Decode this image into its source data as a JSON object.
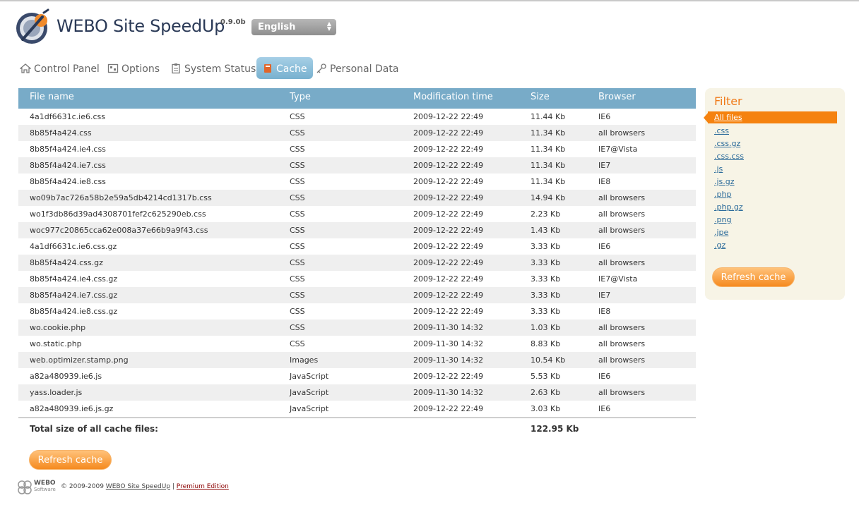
{
  "header": {
    "title": "WEBO Site SpeedUp",
    "version": "0.9.0b",
    "language": "English"
  },
  "nav": {
    "tabs": [
      {
        "label": "Control Panel",
        "icon": "home-icon"
      },
      {
        "label": "Options",
        "icon": "options-icon"
      },
      {
        "label": "System Status",
        "icon": "clipboard-icon"
      },
      {
        "label": "Cache",
        "icon": "book-icon",
        "active": true
      },
      {
        "label": "Personal Data",
        "icon": "key-icon"
      }
    ]
  },
  "table": {
    "headers": [
      "File name",
      "Type",
      "Modification time",
      "Size",
      "Browser"
    ],
    "rows": [
      [
        "4a1df6631c.ie6.css",
        "CSS",
        "2009-12-22 22:49",
        "11.44 Kb",
        "IE6"
      ],
      [
        "8b85f4a424.css",
        "CSS",
        "2009-12-22 22:49",
        "11.34 Kb",
        "all browsers"
      ],
      [
        "8b85f4a424.ie4.css",
        "CSS",
        "2009-12-22 22:49",
        "11.34 Kb",
        "IE7@Vista"
      ],
      [
        "8b85f4a424.ie7.css",
        "CSS",
        "2009-12-22 22:49",
        "11.34 Kb",
        "IE7"
      ],
      [
        "8b85f4a424.ie8.css",
        "CSS",
        "2009-12-22 22:49",
        "11.34 Kb",
        "IE8"
      ],
      [
        "wo09b7ac726a58b2e59a5db4214cd1317b.css",
        "CSS",
        "2009-12-22 22:49",
        "14.94 Kb",
        "all browsers"
      ],
      [
        "wo1f3db86d39ad4308701fef2c625290eb.css",
        "CSS",
        "2009-12-22 22:49",
        "2.23 Kb",
        "all browsers"
      ],
      [
        "woc977c20865cca62e008a37e66b9a9f43.css",
        "CSS",
        "2009-12-22 22:49",
        "1.43 Kb",
        "all browsers"
      ],
      [
        "4a1df6631c.ie6.css.gz",
        "CSS",
        "2009-12-22 22:49",
        "3.33 Kb",
        "IE6"
      ],
      [
        "8b85f4a424.css.gz",
        "CSS",
        "2009-12-22 22:49",
        "3.33 Kb",
        "all browsers"
      ],
      [
        "8b85f4a424.ie4.css.gz",
        "CSS",
        "2009-12-22 22:49",
        "3.33 Kb",
        "IE7@Vista"
      ],
      [
        "8b85f4a424.ie7.css.gz",
        "CSS",
        "2009-12-22 22:49",
        "3.33 Kb",
        "IE7"
      ],
      [
        "8b85f4a424.ie8.css.gz",
        "CSS",
        "2009-12-22 22:49",
        "3.33 Kb",
        "IE8"
      ],
      [
        "wo.cookie.php",
        "CSS",
        "2009-11-30 14:32",
        "1.03 Kb",
        "all browsers"
      ],
      [
        "wo.static.php",
        "CSS",
        "2009-11-30 14:32",
        "8.83 Kb",
        "all browsers"
      ],
      [
        "web.optimizer.stamp.png",
        "Images",
        "2009-11-30 14:32",
        "10.54 Kb",
        "all browsers"
      ],
      [
        "a82a480939.ie6.js",
        "JavaScript",
        "2009-12-22 22:49",
        "5.53 Kb",
        "IE6"
      ],
      [
        "yass.loader.js",
        "JavaScript",
        "2009-11-30 14:32",
        "2.63 Kb",
        "all browsers"
      ],
      [
        "a82a480939.ie6.js.gz",
        "JavaScript",
        "2009-12-22 22:49",
        "3.03 Kb",
        "IE6"
      ]
    ],
    "total_label": "Total size of all cache files:",
    "total_value": "122.95 Kb"
  },
  "refresh_label": "Refresh cache",
  "filter": {
    "title": "Filter",
    "active": "All files",
    "items": [
      ".css",
      ".css.gz",
      ".css.css",
      ".js",
      ".js.gz",
      ".php",
      ".php.gz",
      ".png",
      ".jpe",
      ".gz"
    ],
    "refresh_label": "Refresh cache"
  },
  "footer": {
    "brand": "WEBO",
    "brand_sub": "Software",
    "copyright": "© 2009-2009",
    "product_link": "WEBO Site SpeedUp",
    "separator": "|",
    "premium_link": "Premium Edition"
  },
  "colors": {
    "header_blue": "#78abc8",
    "accent_orange": "#f5820f",
    "filter_bg": "#f7f4e6"
  }
}
